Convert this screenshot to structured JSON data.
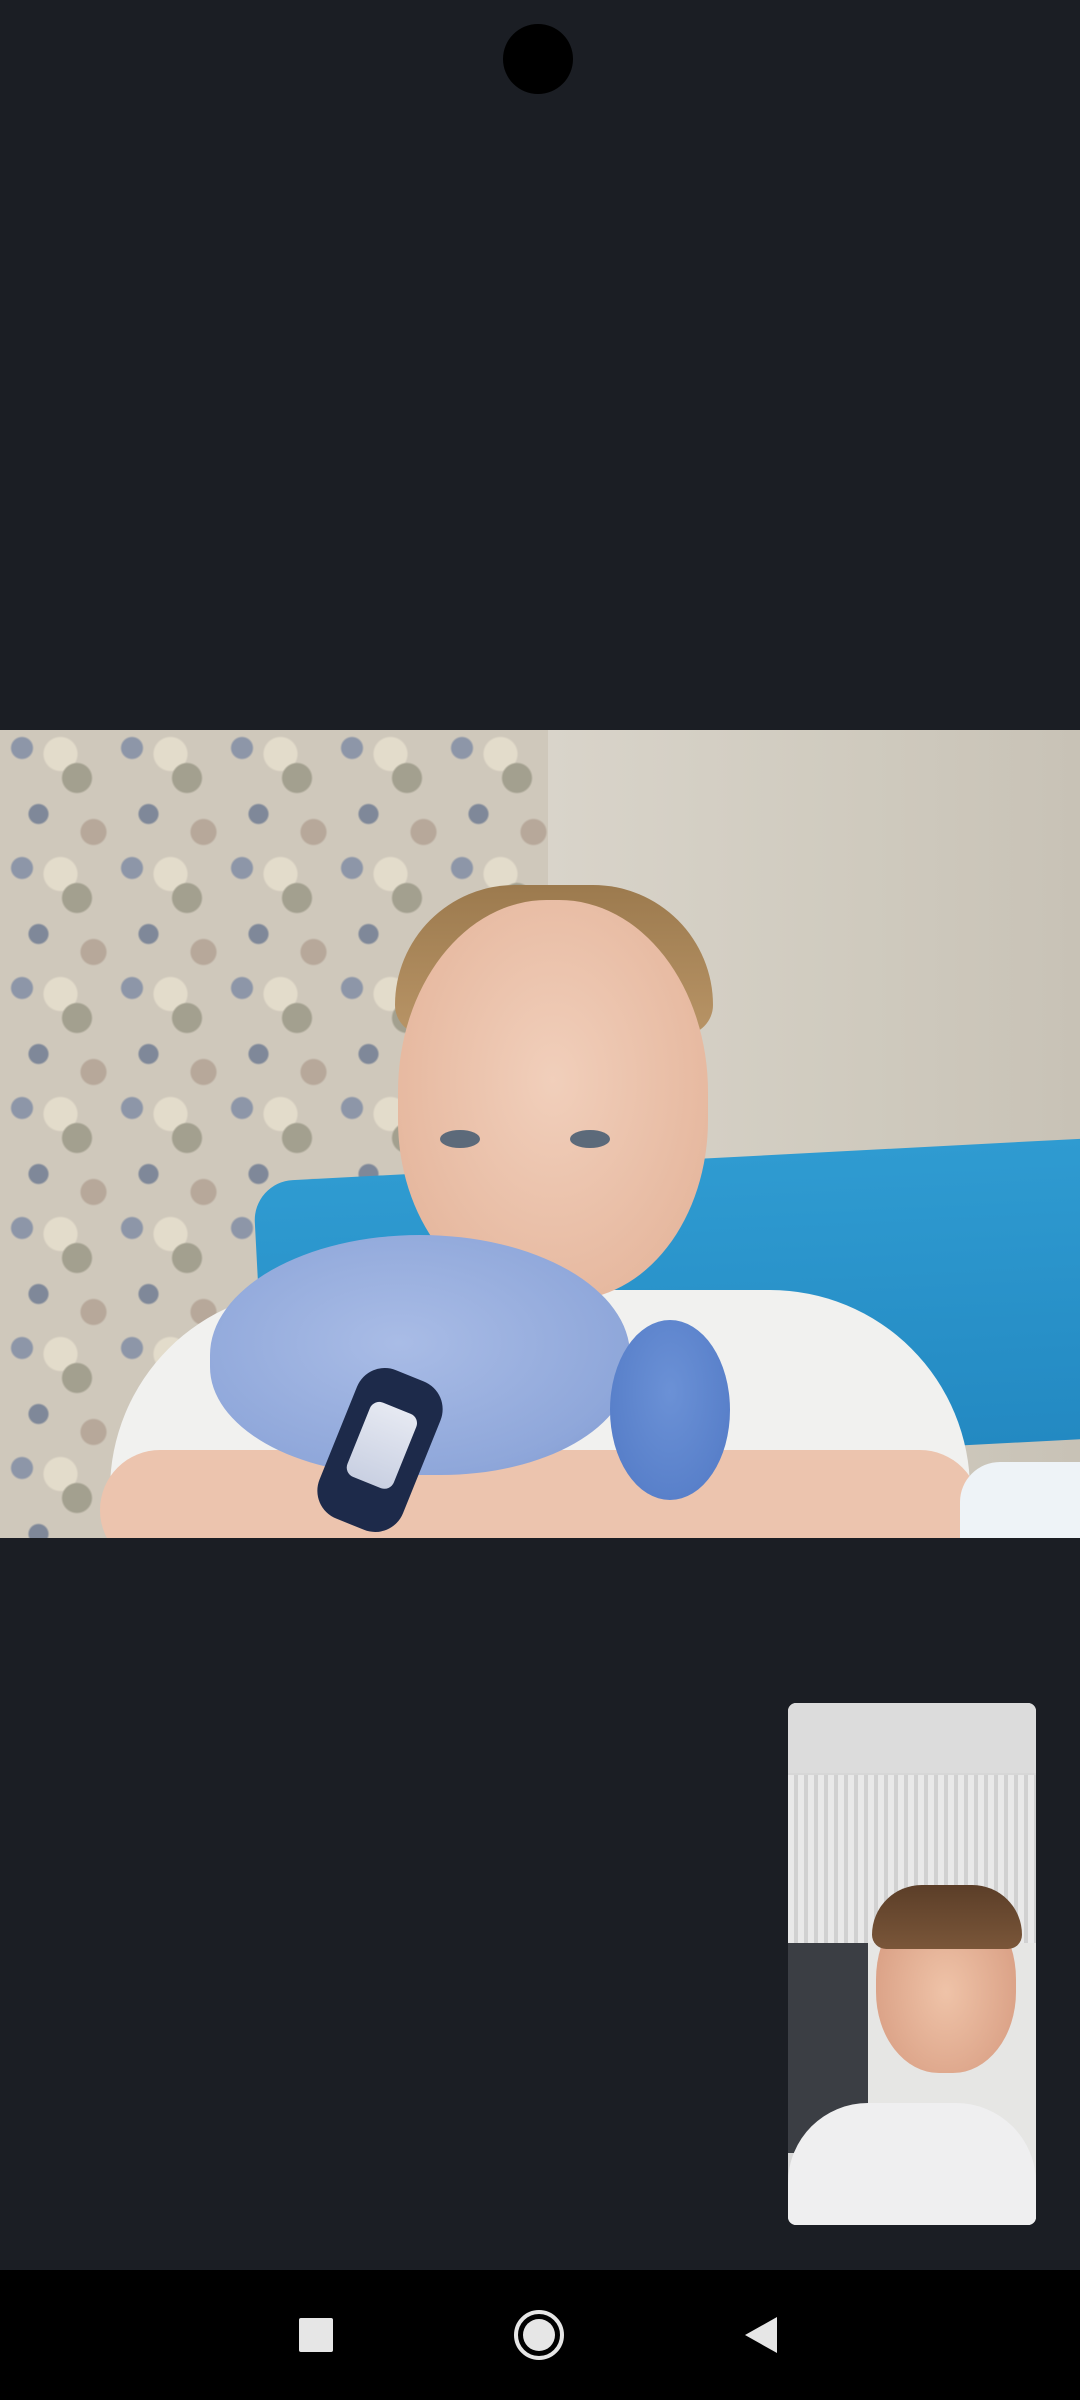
{
  "app": {
    "screen_type": "video-call"
  },
  "call": {
    "remote_participant_video": "remote-camera-feed",
    "local_participant_video": "self-view-camera-feed"
  },
  "navigation_bar": {
    "buttons": [
      {
        "id": "recents",
        "icon": "square-icon"
      },
      {
        "id": "home",
        "icon": "circle-home-icon"
      },
      {
        "id": "back",
        "icon": "triangle-back-icon"
      }
    ]
  },
  "colors": {
    "background": "#1b1e24",
    "nav_bar": "#000000",
    "nav_icon": "#e6e6e6"
  }
}
